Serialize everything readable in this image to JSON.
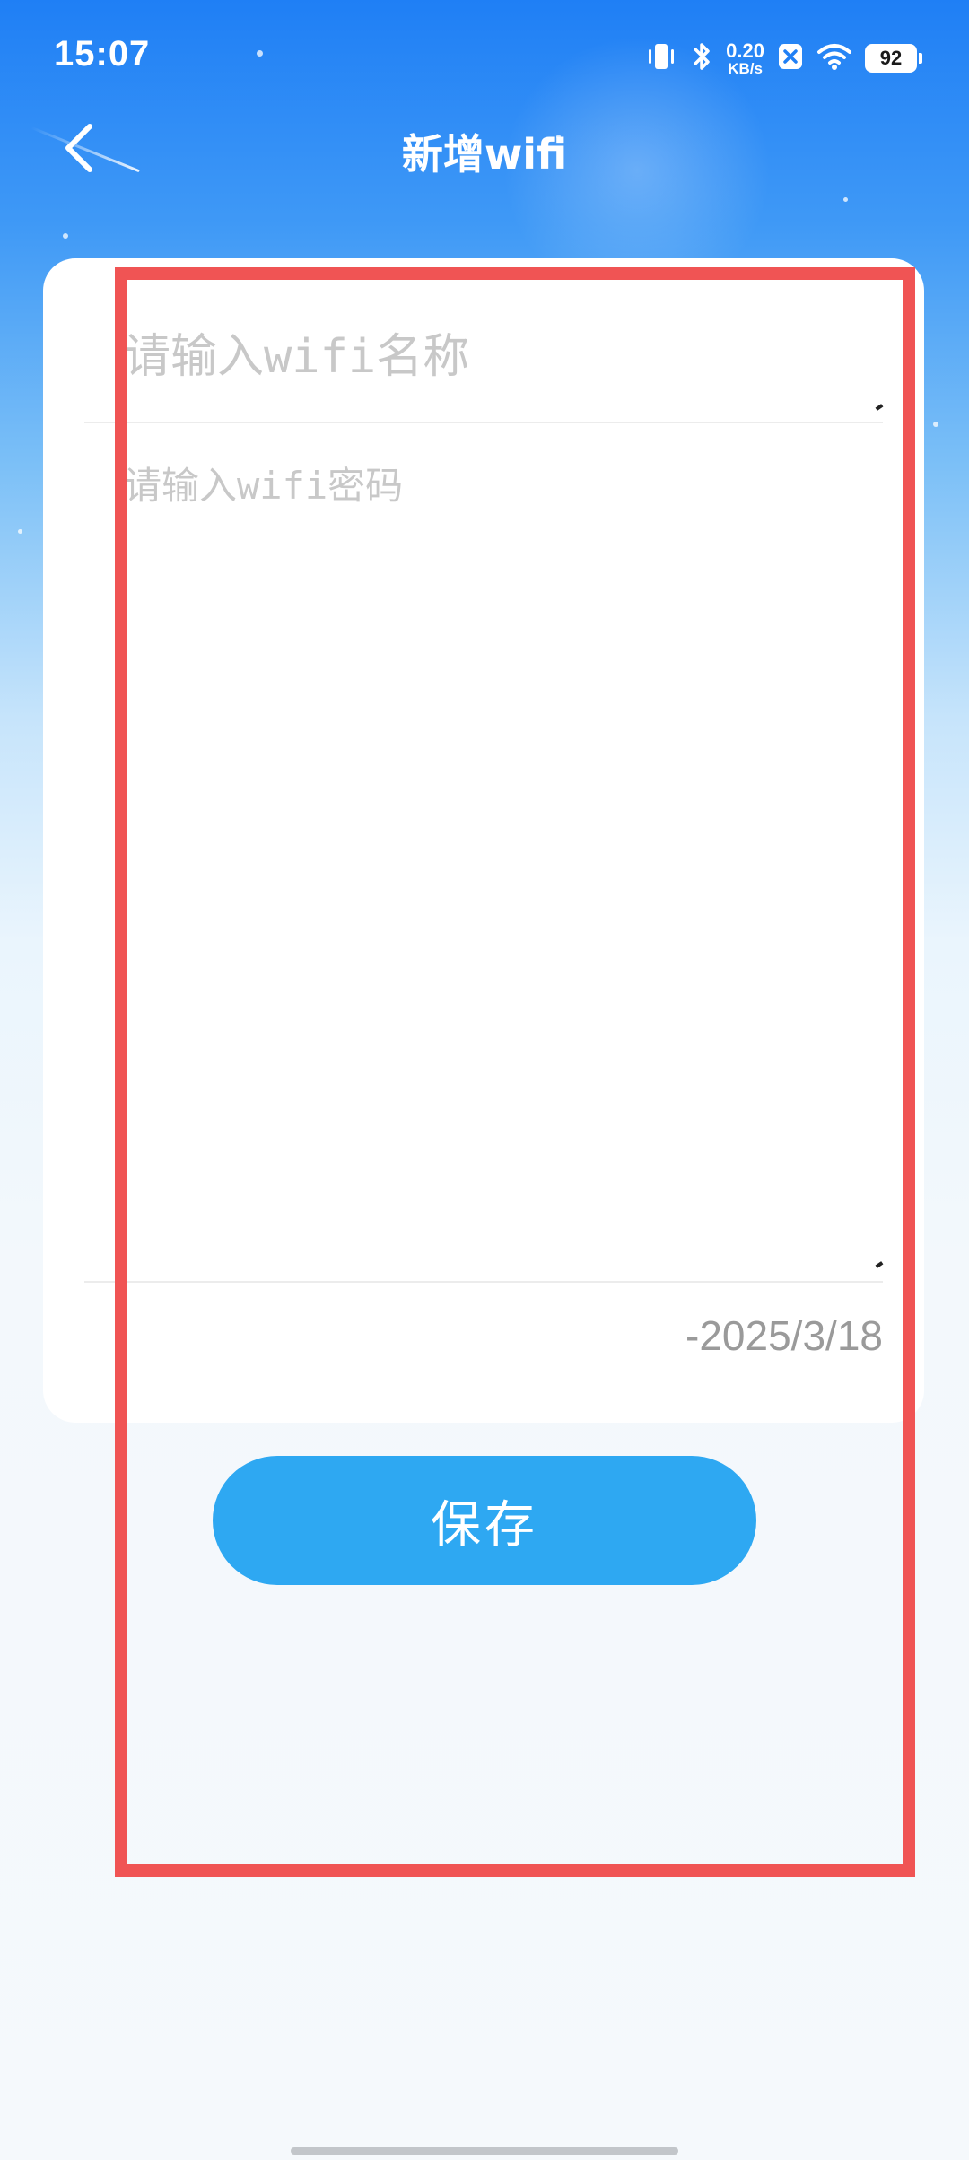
{
  "status_bar": {
    "time": "15:07",
    "net_speed_value": "0.20",
    "net_speed_unit": "KB/s",
    "battery": "92",
    "icons": [
      "vibrate-icon",
      "bluetooth-icon",
      "app-notification-icon",
      "wifi-icon",
      "battery-icon"
    ]
  },
  "header": {
    "back_icon": "chevron-left-icon",
    "title": "新增wifi"
  },
  "form": {
    "name_placeholder": "请输入wifi名称",
    "name_value": "",
    "password_placeholder": "请输入wifi密码",
    "password_value": "",
    "date": "-2025/3/18"
  },
  "actions": {
    "save_label": "保存"
  },
  "colors": {
    "accent": "#2ea8f2",
    "highlight": "#f05454",
    "header_blue": "#1f7ff5"
  }
}
